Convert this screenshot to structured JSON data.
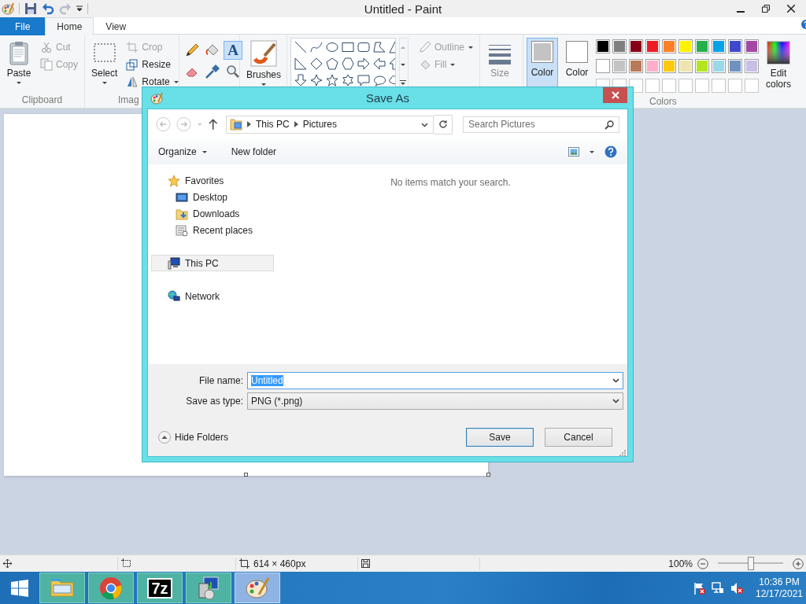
{
  "window": {
    "title": "Untitled - Paint"
  },
  "ribbon": {
    "tabs": [
      {
        "label": "File",
        "kind": "file",
        "selected": false
      },
      {
        "label": "Home",
        "kind": "tab",
        "selected": true
      },
      {
        "label": "View",
        "kind": "tab",
        "selected": false
      }
    ],
    "groups": [
      {
        "kind": "clipboard",
        "label": "Clipboard",
        "big": "Paste",
        "items": [
          {
            "label": "Cut",
            "disabled": true
          },
          {
            "label": "Copy",
            "disabled": true
          }
        ]
      },
      {
        "kind": "image",
        "label": "Imag",
        "big": "Select",
        "items": [
          {
            "label": "Crop",
            "disabled": true
          },
          {
            "label": "Resize",
            "disabled": false
          },
          {
            "label": "Rotate",
            "disabled": false
          }
        ]
      },
      {
        "kind": "tools",
        "tools": [
          {
            "kind": "pencil",
            "selected": false
          },
          {
            "kind": "fill",
            "selected": false
          },
          {
            "kind": "text",
            "glyph": "A",
            "selected": true
          },
          {
            "kind": "eraser",
            "selected": false
          },
          {
            "kind": "picker",
            "selected": false
          },
          {
            "kind": "magnifier",
            "selected": false
          }
        ]
      },
      {
        "kind": "brushes",
        "big": "Brushes"
      },
      {
        "kind": "shapes",
        "items": [
          {
            "label": "Outline",
            "disabled": true
          },
          {
            "label": "Fill",
            "disabled": true
          }
        ]
      },
      {
        "kind": "size",
        "big": "Size"
      },
      {
        "kind": "colors",
        "label": "Colors",
        "slots": [
          {
            "label": "Color",
            "color": "#c3c3c3",
            "selected": true
          },
          {
            "label": "Color",
            "color": "#ffffff",
            "selected": false
          }
        ],
        "palette": [
          {
            "kind": "swatch",
            "color": "#000000"
          },
          {
            "kind": "swatch",
            "color": "#7f7f7f"
          },
          {
            "kind": "swatch",
            "color": "#880015"
          },
          {
            "kind": "swatch",
            "color": "#ed1c24"
          },
          {
            "kind": "swatch",
            "color": "#ff7f27"
          },
          {
            "kind": "swatch",
            "color": "#fff200"
          },
          {
            "kind": "swatch",
            "color": "#22b14c"
          },
          {
            "kind": "swatch",
            "color": "#00a2e8"
          },
          {
            "kind": "swatch",
            "color": "#3f48cc"
          },
          {
            "kind": "swatch",
            "color": "#a349a4"
          },
          {
            "kind": "swatch",
            "color": "#ffffff"
          },
          {
            "kind": "swatch",
            "color": "#c3c3c3"
          },
          {
            "kind": "swatch",
            "color": "#b97a57"
          },
          {
            "kind": "swatch",
            "color": "#ffaec9"
          },
          {
            "kind": "swatch",
            "color": "#ffc90e"
          },
          {
            "kind": "swatch",
            "color": "#efe4b0"
          },
          {
            "kind": "swatch",
            "color": "#b5e61d"
          },
          {
            "kind": "swatch",
            "color": "#99d9ea"
          },
          {
            "kind": "swatch",
            "color": "#7092be"
          },
          {
            "kind": "swatch",
            "color": "#c8bfe7"
          },
          {
            "kind": "empty"
          },
          {
            "kind": "empty"
          },
          {
            "kind": "empty"
          },
          {
            "kind": "empty"
          },
          {
            "kind": "empty"
          },
          {
            "kind": "empty"
          },
          {
            "kind": "empty"
          },
          {
            "kind": "empty"
          },
          {
            "kind": "empty"
          },
          {
            "kind": "empty"
          }
        ],
        "edit": "Edit colors"
      }
    ]
  },
  "status_bar": {
    "dimensions": "614 × 460px",
    "zoom": "100%",
    "zoom_slider": {
      "level": 0.5
    }
  },
  "dialog": {
    "title": "Save As",
    "breadcrumb": [
      "This PC",
      "Pictures"
    ],
    "search": {
      "placeholder": "Search Pictures"
    },
    "toolbar": {
      "organize": "Organize",
      "new_folder": "New folder"
    },
    "nav": [
      {
        "label": "Favorites",
        "kind": "favorites",
        "selected": false,
        "children": [
          {
            "label": "Desktop",
            "kind": "desktop",
            "selected": false
          },
          {
            "label": "Downloads",
            "kind": "downloads",
            "selected": false
          },
          {
            "label": "Recent places",
            "kind": "recent",
            "selected": false
          }
        ]
      },
      {
        "label": "This PC",
        "kind": "pc",
        "selected": true
      },
      {
        "label": "Network",
        "kind": "network",
        "selected": false
      }
    ],
    "message": "No items match your search.",
    "fields": [
      {
        "label": "File name:",
        "value": "Untitled",
        "text_selected": true
      },
      {
        "label": "Save as type:",
        "value": "PNG (*.png)",
        "text_selected": false
      }
    ],
    "hide_folders": "Hide Folders",
    "buttons": [
      {
        "label": "Save",
        "default": true
      },
      {
        "label": "Cancel",
        "default": false
      }
    ]
  },
  "taskbar": {
    "apps": [
      {
        "kind": "explorer",
        "selected": false
      },
      {
        "kind": "browser",
        "selected": false
      },
      {
        "kind": "archiver",
        "label": "7z",
        "selected": false
      },
      {
        "kind": "installer",
        "selected": false
      },
      {
        "kind": "paint",
        "selected": true
      }
    ],
    "clock": {
      "time": "10:36 PM",
      "date": "12/17/2021"
    }
  }
}
